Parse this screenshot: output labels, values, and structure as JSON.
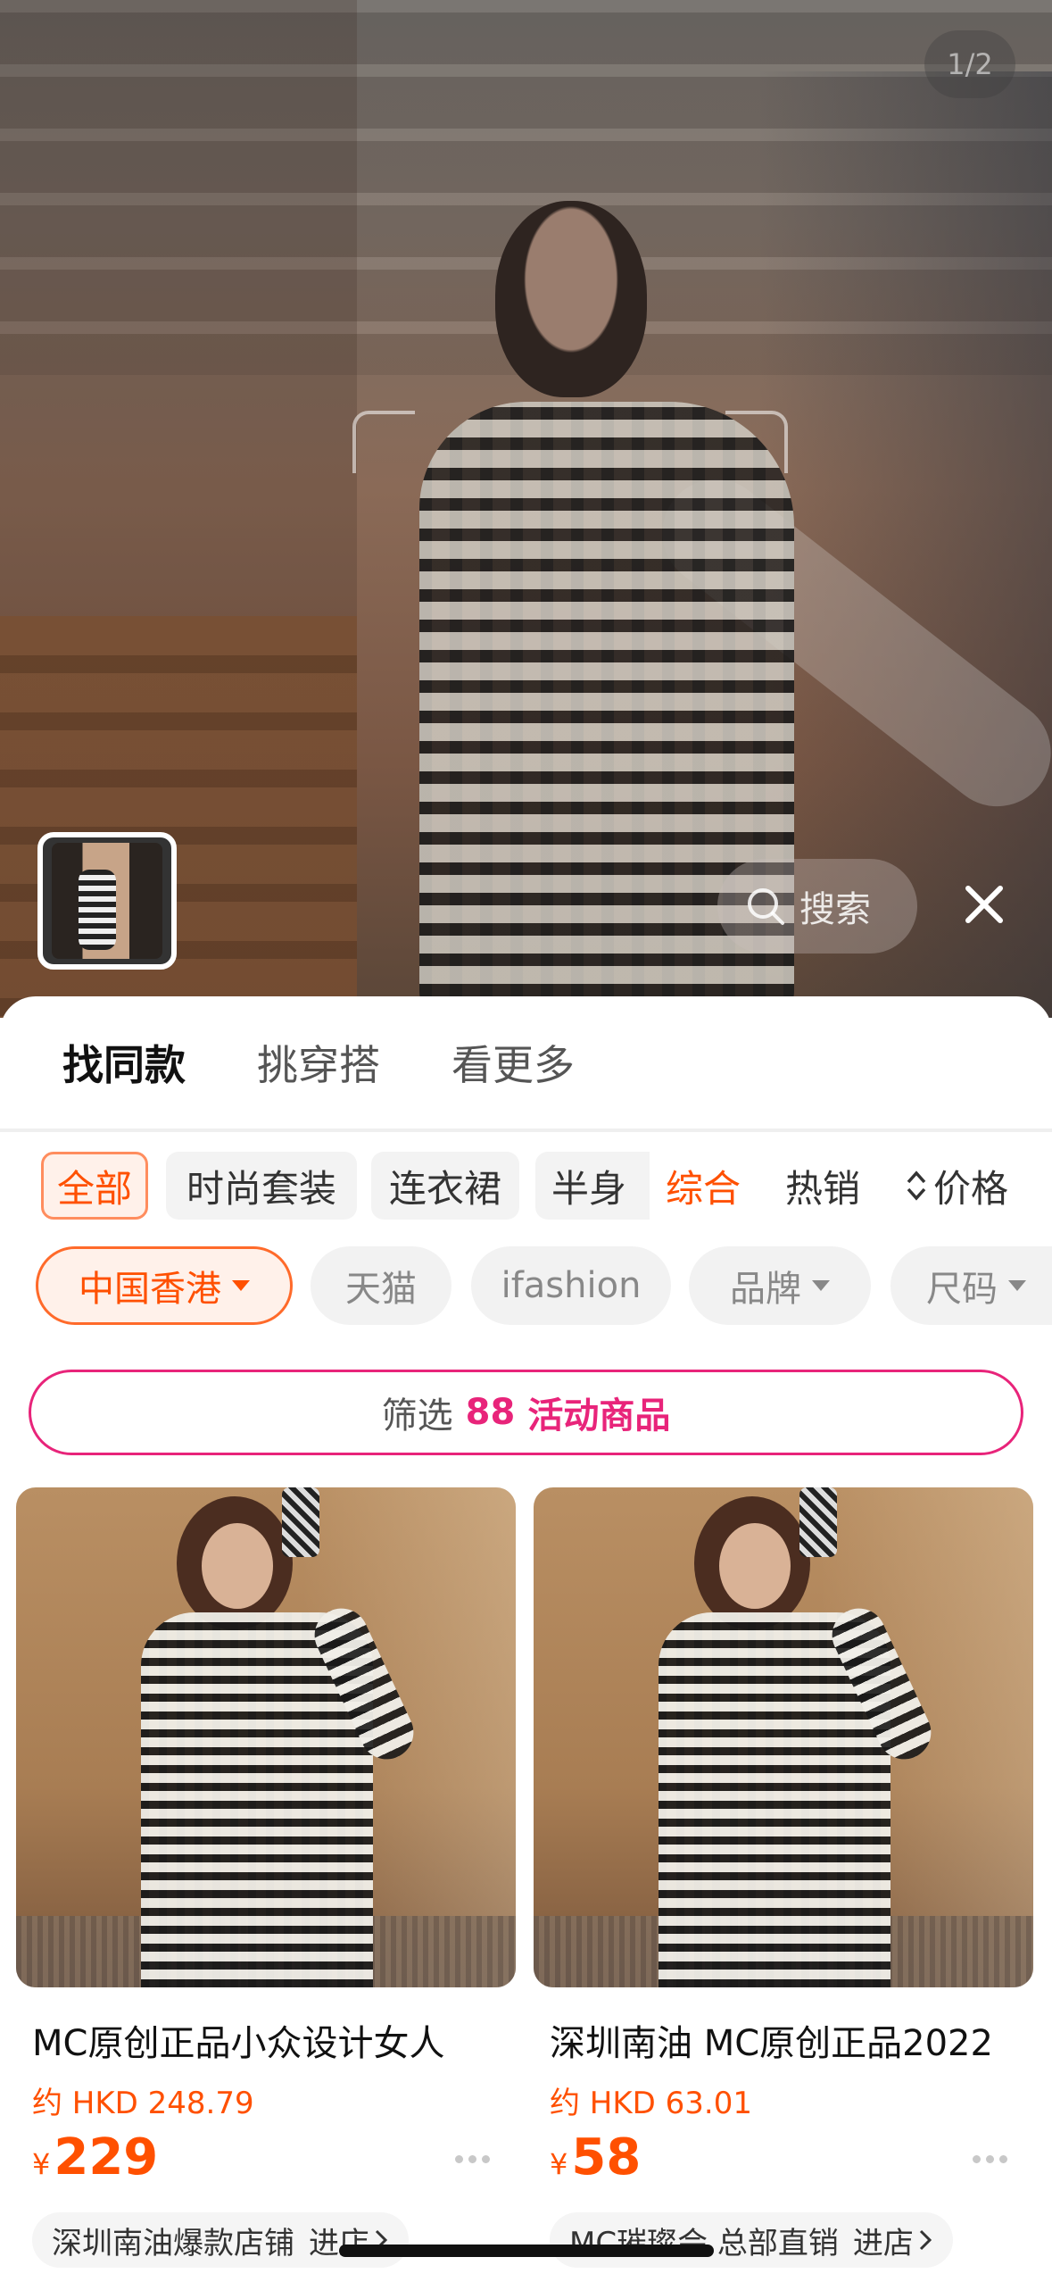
{
  "hero": {
    "page_indicator": "1/2",
    "search_label": "搜索"
  },
  "tabs": [
    "找同款",
    "挑穿搭",
    "看更多"
  ],
  "category_chips": [
    "全部",
    "时尚套装",
    "连衣裙",
    "半身"
  ],
  "sort": {
    "comprehensive": "综合",
    "hot": "热销",
    "price": "价格"
  },
  "filters": {
    "region": "中国香港",
    "tmall": "天猫",
    "ifashion": "ifashion",
    "brand": "品牌",
    "size": "尺码"
  },
  "promo": {
    "prefix": "筛选",
    "number": "88",
    "label": "活动商品"
  },
  "products": [
    {
      "title": "MC原创正品小众设计女人",
      "approx_price": "约 HKD 248.79",
      "currency": "¥",
      "price": "229",
      "shop": "深圳南油爆款店铺",
      "enter": "进店"
    },
    {
      "title": "深圳南油 MC原创正品2022",
      "approx_price": "约 HKD 63.01",
      "currency": "¥",
      "price": "58",
      "shop": "MC璀璨会 总部直销",
      "enter": "进店"
    }
  ],
  "colors": {
    "accent": "#ff5000",
    "promo": "#e8247a"
  }
}
